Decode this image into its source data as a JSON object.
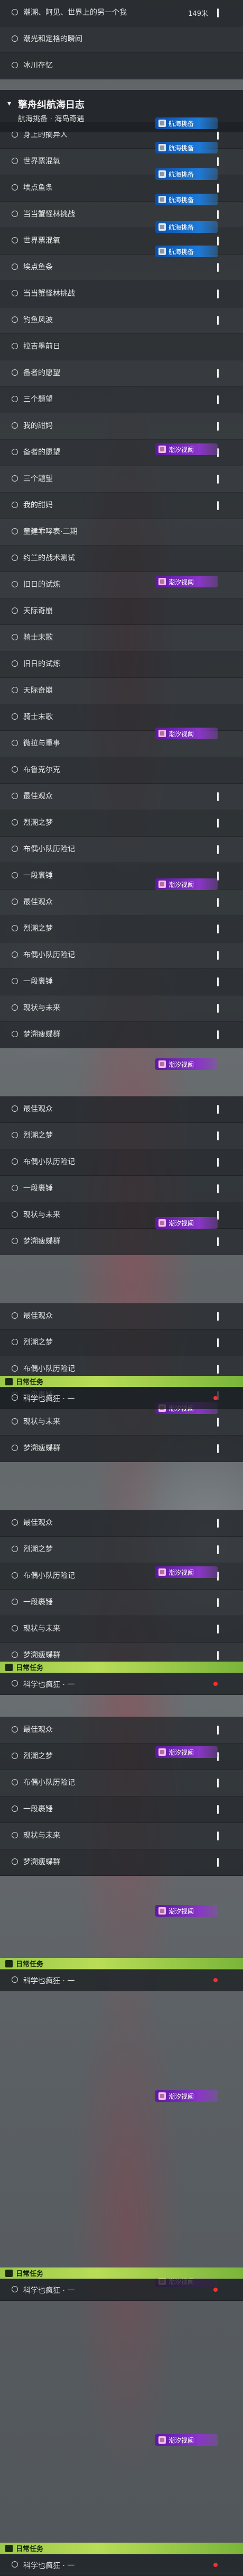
{
  "rows": [
    {
      "label": "潮潮、阿见、世界上的另一个我",
      "meta": "149米",
      "pin": true
    },
    {
      "label": "潮光和定格的瞬间"
    },
    {
      "label": "冰川存忆"
    },
    {
      "label": "",
      "header": true
    },
    {
      "label": "身上的摘异人",
      "pin": true
    },
    {
      "label": "世界票混氧",
      "pin": true
    },
    {
      "label": "埃点鱼条",
      "pin": true
    },
    {
      "label": "当当蟹怪林挑战",
      "pin": true
    },
    {
      "label": "世界票混氧",
      "pin": true
    },
    {
      "label": "埃点鱼条",
      "pin": true
    },
    {
      "label": "当当蟹怪林挑战",
      "pin": true
    },
    {
      "label": "钓鱼风波",
      "pin": true
    },
    {
      "label": "拉吉墨前日"
    },
    {
      "label": "备者的愿望",
      "pin": true
    },
    {
      "label": "三个题望",
      "pin": true
    },
    {
      "label": "我的甜妈",
      "pin": true
    },
    {
      "label": "备者的愿望",
      "pin": true
    },
    {
      "label": "三个题望",
      "pin": true
    },
    {
      "label": "我的甜妈",
      "pin": true
    },
    {
      "label": "童建乖哮表·二期"
    },
    {
      "label": "约兰的战术测试"
    },
    {
      "label": "旧日的试炼"
    },
    {
      "label": "天际奇崩"
    },
    {
      "label": "骑士末歌"
    },
    {
      "label": "旧日的试炼"
    },
    {
      "label": "天际奇崩"
    },
    {
      "label": "骑士末歌"
    },
    {
      "label": "微拉与重事"
    },
    {
      "label": "布鲁克尔克"
    },
    {
      "label": "最佳观众",
      "pin": true
    },
    {
      "label": "烈潮之梦",
      "pin": true
    },
    {
      "label": "布偶小队历险记",
      "pin": true
    },
    {
      "label": "一段裹锤",
      "pin": true
    },
    {
      "label": "最佳观众",
      "pin": true
    },
    {
      "label": "烈潮之梦",
      "pin": true
    },
    {
      "label": "布偶小队历险记",
      "pin": true
    },
    {
      "label": "一段裹锤",
      "pin": true
    },
    {
      "label": "现状与未来",
      "pin": true
    },
    {
      "label": "梦溯瘦蝶群",
      "pin": true
    },
    {
      "label": "",
      "gap": true
    },
    {
      "label": "最佳观众",
      "pin": true
    },
    {
      "label": "烈潮之梦",
      "pin": true
    },
    {
      "label": "布偶小队历险记",
      "pin": true
    },
    {
      "label": "一段裹锤",
      "pin": true
    },
    {
      "label": "现状与未来",
      "pin": true
    },
    {
      "label": "梦溯瘦蝶群",
      "pin": true
    },
    {
      "label": "",
      "gap": true
    },
    {
      "label": "最佳观众",
      "pin": true
    },
    {
      "label": "烈潮之梦",
      "pin": true
    },
    {
      "label": "布偶小队历险记",
      "pin": true
    },
    {
      "label": "一段裹锤",
      "pin": true
    },
    {
      "label": "现状与未来",
      "pin": true
    },
    {
      "label": "梦溯瘦蝶群",
      "pin": true
    },
    {
      "label": "",
      "gap": true
    },
    {
      "label": "最佳观众",
      "pin": true
    },
    {
      "label": "烈潮之梦",
      "pin": true
    },
    {
      "label": "布偶小队历险记",
      "pin": true
    },
    {
      "label": "一段裹锤",
      "pin": true
    },
    {
      "label": "现状与未来",
      "pin": true
    },
    {
      "label": "梦溯瘦蝶群",
      "pin": true
    },
    {
      "label": "",
      "gap": true
    },
    {
      "label": "最佳观众",
      "pin": true
    },
    {
      "label": "烈潮之梦",
      "pin": true
    },
    {
      "label": "布偶小队历险记",
      "pin": true
    },
    {
      "label": "一段裹锤",
      "pin": true
    },
    {
      "label": "现状与未来",
      "pin": true
    },
    {
      "label": "梦溯瘦蝶群",
      "pin": true
    }
  ],
  "header": {
    "title": "擎舟纠航海日志",
    "subtitle": "航海挑备 · 海岛奇遇"
  },
  "tags": {
    "blue_label": "航海挑备",
    "purple_label": "潮汐视阈"
  },
  "daily": {
    "bar_label": "日常任务",
    "row_label": "科学也疯狂 · 一"
  },
  "colors": {
    "accent_green": "#b9dd57",
    "red_dot": "#ee3333",
    "blue": "#1d7ad8",
    "purple": "#8a35c8"
  }
}
